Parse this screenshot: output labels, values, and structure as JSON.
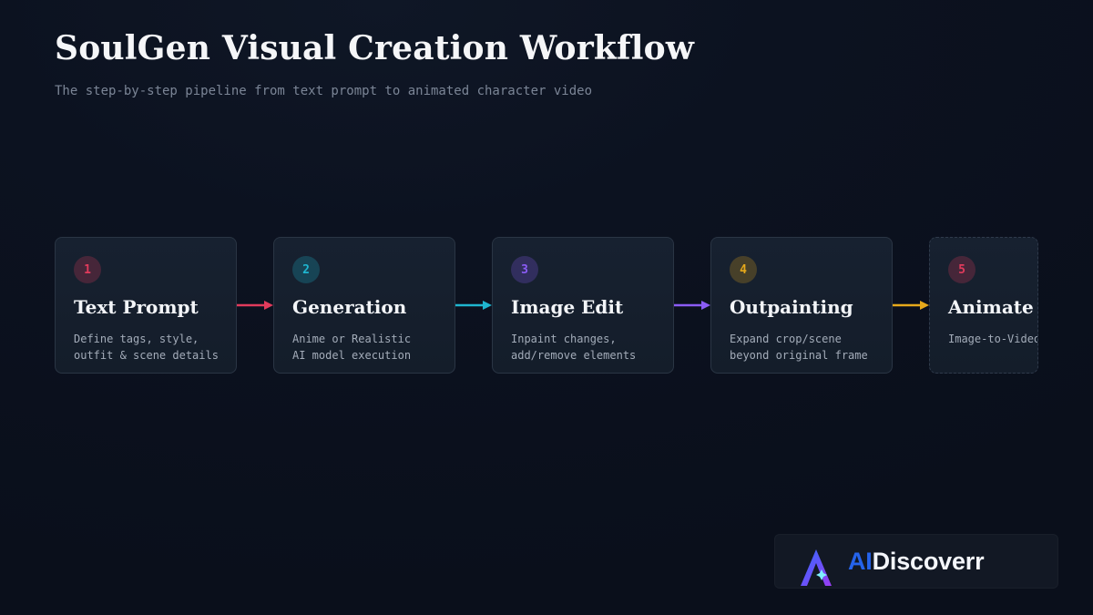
{
  "header": {
    "title": "SoulGen Visual Creation Workflow",
    "subtitle": "The step-by-step pipeline from text prompt to animated character video"
  },
  "steps": [
    {
      "number": "1",
      "title": "Text Prompt",
      "desc_lines": [
        "Define tags, style,",
        "outfit & scene details"
      ],
      "color": "#e23b5c"
    },
    {
      "number": "2",
      "title": "Generation",
      "desc_lines": [
        "Anime or Realistic",
        "AI model execution"
      ],
      "color": "#1fb6d0"
    },
    {
      "number": "3",
      "title": "Image Edit",
      "desc_lines": [
        "Inpaint changes,",
        "add/remove elements"
      ],
      "color": "#8b5cf6"
    },
    {
      "number": "4",
      "title": "Outpainting",
      "desc_lines": [
        "Expand crop/scene",
        "beyond original frame"
      ],
      "color": "#e7a91b"
    },
    {
      "number": "5",
      "title": "Animate",
      "desc_lines": [
        "Image-to-Video"
      ],
      "color": "#e23b5c"
    }
  ],
  "logo": {
    "ai": "AI",
    "rest": "Discoverr"
  }
}
